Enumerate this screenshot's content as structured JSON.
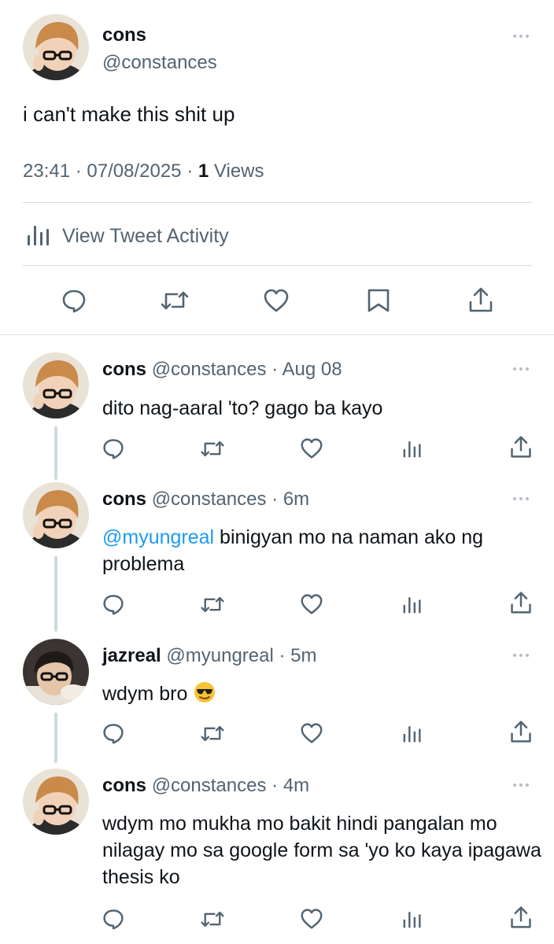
{
  "main_tweet": {
    "display_name": "cons",
    "handle": "@constances",
    "text": "i can't make this shit up",
    "time": "23:41",
    "date": "07/08/2025",
    "views_count": "1",
    "views_label": "Views",
    "activity_label": "View Tweet Activity"
  },
  "replies": [
    {
      "display_name": "cons",
      "handle": "@constances",
      "time": "Aug 08",
      "text": "dito nag-aaral 'to? gago ba kayo"
    },
    {
      "display_name": "cons",
      "handle": "@constances",
      "time": "6m",
      "mention": "@myungreal",
      "text": " binigyan mo na naman ako ng problema"
    },
    {
      "display_name": "jazreal",
      "handle": "@myungreal",
      "time": "5m",
      "text": "wdym bro",
      "emoji": "😎"
    },
    {
      "display_name": "cons",
      "handle": "@constances",
      "time": "4m",
      "text": "wdym mo mukha mo bakit hindi pangalan mo nilagay mo sa google form sa 'yo ko kaya ipagawa thesis ko"
    }
  ],
  "separator": "·",
  "colors": {
    "accent": "#1d9bf0",
    "muted": "#536471",
    "divider": "#d7dbdf"
  }
}
